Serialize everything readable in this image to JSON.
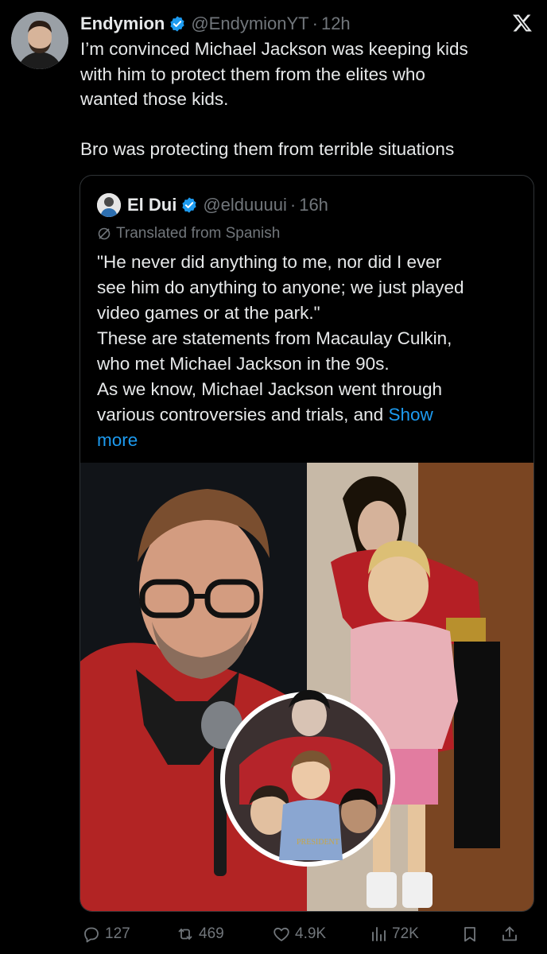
{
  "tweet": {
    "author_name": "Endymion",
    "handle": "@EndymionYT",
    "separator": "·",
    "time": "12h",
    "text": "I’m convinced Michael Jackson was keeping kids\nwith him to protect them from the elites who\nwanted those kids.\n\nBro was protecting them from terrible situations"
  },
  "quote": {
    "author_name": "El Dui",
    "handle": "@elduuuui",
    "separator": "·",
    "time": "16h",
    "translated_label": "Translated from Spanish",
    "text": "\"He never did anything to me, nor did I ever\nsee him do anything to anyone; we just played\nvideo games or at the park.\"\nThese are statements from Macaulay Culkin,\nwho met Michael Jackson in the 90s.\nAs we know, Michael Jackson went through\nvarious controversies and trials, and ",
    "show_more": "Show\nmore",
    "inset_caption": "PRESIDENT"
  },
  "actions": {
    "replies": "127",
    "reposts": "469",
    "likes": "4.9K",
    "views": "72K"
  },
  "colors": {
    "accent": "#1d9bf0",
    "muted": "#71767b",
    "text": "#e7e9ea"
  }
}
